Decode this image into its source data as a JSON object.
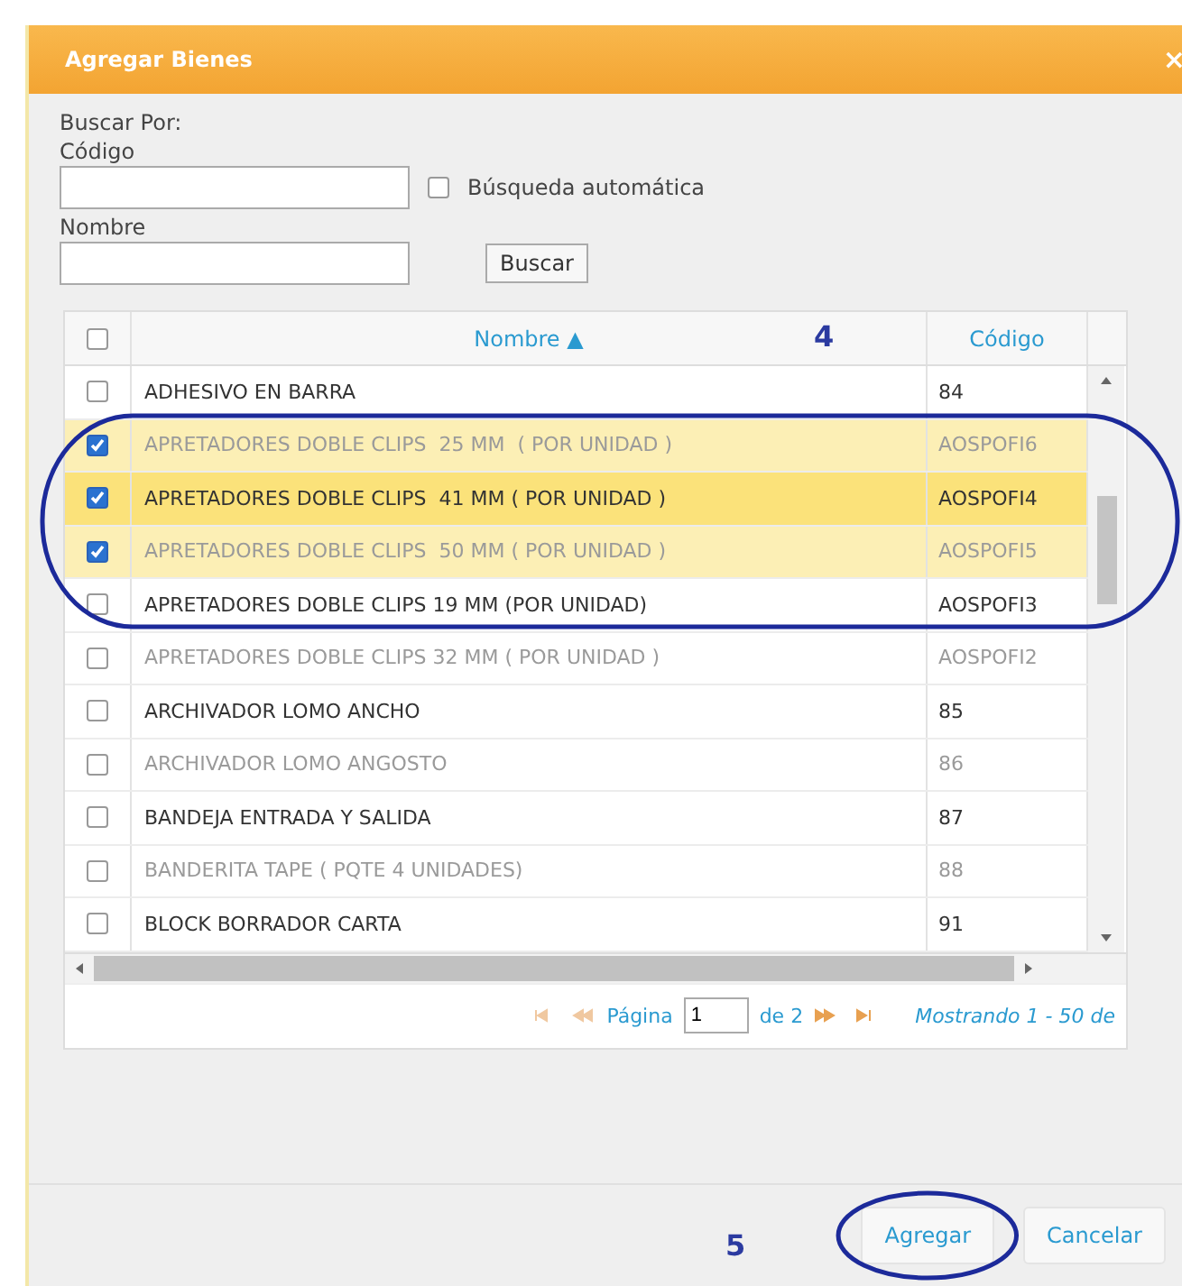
{
  "dialog": {
    "title": "Agregar Bienes",
    "close": "×"
  },
  "search": {
    "heading": "Buscar Por:",
    "code_label": "Código",
    "auto_search": {
      "label": "Búsqueda automática",
      "checked": false
    },
    "name_label": "Nombre",
    "button": "Buscar"
  },
  "table": {
    "header_checked": false,
    "columns": [
      {
        "label": "Nombre",
        "sort": "▲"
      },
      {
        "label": "Código"
      }
    ],
    "rows": [
      {
        "name": "ADHESIVO EN BARRA",
        "code": "84",
        "checked": false,
        "hover": false
      },
      {
        "name": "APRETADORES DOBLE CLIPS  25 MM  ( POR UNIDAD )",
        "code": "AOSPOFI6",
        "checked": true,
        "hover": false
      },
      {
        "name": "APRETADORES DOBLE CLIPS  41 MM ( POR UNIDAD )",
        "code": "AOSPOFI4",
        "checked": true,
        "hover": true
      },
      {
        "name": "APRETADORES DOBLE CLIPS  50 MM ( POR UNIDAD )",
        "code": "AOSPOFI5",
        "checked": true,
        "hover": false
      },
      {
        "name": "APRETADORES DOBLE CLIPS 19 MM (POR UNIDAD)",
        "code": "AOSPOFI3",
        "checked": false,
        "hover": false
      },
      {
        "name": "APRETADORES DOBLE CLIPS 32 MM ( POR UNIDAD )",
        "code": "AOSPOFI2",
        "checked": false,
        "hover": false
      },
      {
        "name": "ARCHIVADOR LOMO ANCHO",
        "code": "85",
        "checked": false,
        "hover": false
      },
      {
        "name": "ARCHIVADOR LOMO ANGOSTO",
        "code": "86",
        "checked": false,
        "hover": false
      },
      {
        "name": "BANDEJA ENTRADA Y SALIDA",
        "code": "87",
        "checked": false,
        "hover": false
      },
      {
        "name": "BANDERITA TAPE ( PQTE 4 UNIDADES)",
        "code": "88",
        "checked": false,
        "hover": false
      },
      {
        "name": "BLOCK BORRADOR CARTA",
        "code": "91",
        "checked": false,
        "hover": false
      }
    ]
  },
  "pager": {
    "page_label": "Página",
    "page": "1",
    "of": "de 2",
    "summary": "Mostrando 1 - 50 de"
  },
  "buttons": [
    "Agregar",
    "Cancelar"
  ],
  "annotations": [
    "4",
    "5"
  ]
}
